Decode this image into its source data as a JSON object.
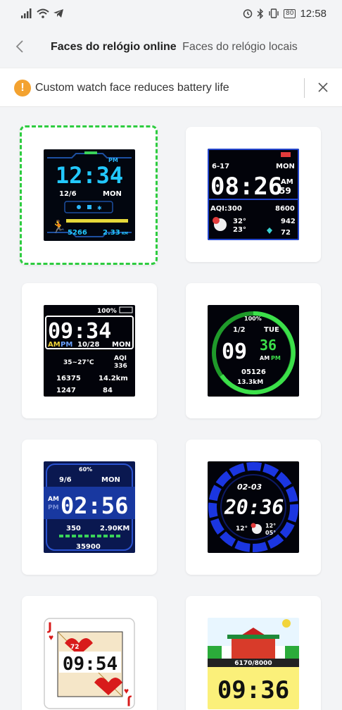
{
  "status": {
    "time": "12:58",
    "battery": "80"
  },
  "header": {
    "tab_online": "Faces do relógio online",
    "tab_local": "Faces do relógio locais"
  },
  "banner": {
    "text": "Custom watch face reduces battery life"
  },
  "faces": {
    "f1": {
      "pm": "PM",
      "time": "12:34",
      "date": "12/6",
      "day": "MON",
      "steps": "5266",
      "dist": "2.33",
      "unit": "KM"
    },
    "f2": {
      "date": "6-17",
      "day": "MON",
      "time": "08:26",
      "ampm": "AM",
      "sec": "59",
      "aqi": "AQI:300",
      "steps": "8600",
      "temp_hi": "32°",
      "temp_lo": "23°",
      "kcal": "942",
      "hr": "72"
    },
    "f3": {
      "battery": "100%",
      "time": "09:34",
      "am": "AM",
      "pm": "PM",
      "date": "10/28",
      "day": "MON",
      "temp": "35~27℃",
      "aqi_label": "AQI",
      "aqi": "336",
      "steps": "16375",
      "dist": "14.2km",
      "kcal": "1247",
      "hr": "84"
    },
    "f4": {
      "battery": "100%",
      "date": "1/2",
      "day": "TUE",
      "hour": "09",
      "min": "36",
      "am": "AM",
      "pm": "PM",
      "steps": "05126",
      "dist": "13.3kM"
    },
    "f5": {
      "battery": "60%",
      "date": "9/6",
      "day": "MON",
      "am": "AM",
      "pm": "PM",
      "time": "02:56",
      "kcal": "350",
      "dist": "2.90KM",
      "steps": "35900"
    },
    "f6": {
      "date": "02-03",
      "time": "20:36",
      "temp_hi": "12°",
      "temp_lo": "05°"
    },
    "f7": {
      "rank": "J",
      "hr": "72",
      "time": "09:54"
    },
    "f8": {
      "steps": "6170/8000",
      "time": "09:36"
    }
  }
}
